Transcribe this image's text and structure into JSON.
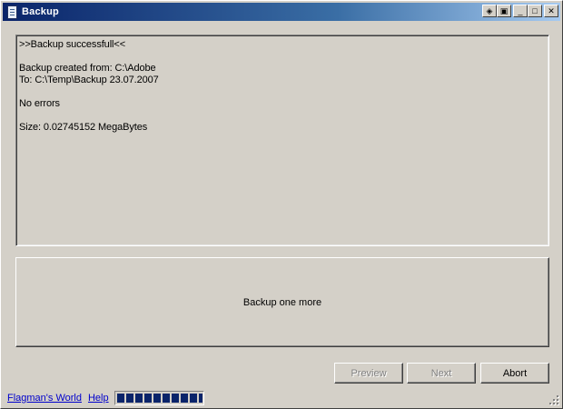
{
  "window": {
    "title": "Backup",
    "icon": "document-icon"
  },
  "title_buttons": {
    "pin": "◈",
    "restore_small": "▣",
    "minimize": "_",
    "maximize": "□",
    "close": "✕"
  },
  "output": {
    "lines": [
      ">>Backup successfull<<",
      "",
      "Backup created from: C:\\Adobe",
      "To: C:\\Temp\\Backup 23.07.2007",
      "",
      "No errors",
      "",
      "Size: 0.02745152 MegaBytes"
    ]
  },
  "actions": {
    "big_button_label": "Backup one more",
    "preview_label": "Preview",
    "next_label": "Next",
    "abort_label": "Abort"
  },
  "statusbar": {
    "link_flagman": "Flagman's World",
    "link_help": "Help",
    "progress_fraction": 1.0
  },
  "colors": {
    "face": "#d4d0c8",
    "title_start": "#0a246a",
    "title_end": "#a6caf0",
    "progress": "#0a246a",
    "link": "#0000cc"
  }
}
